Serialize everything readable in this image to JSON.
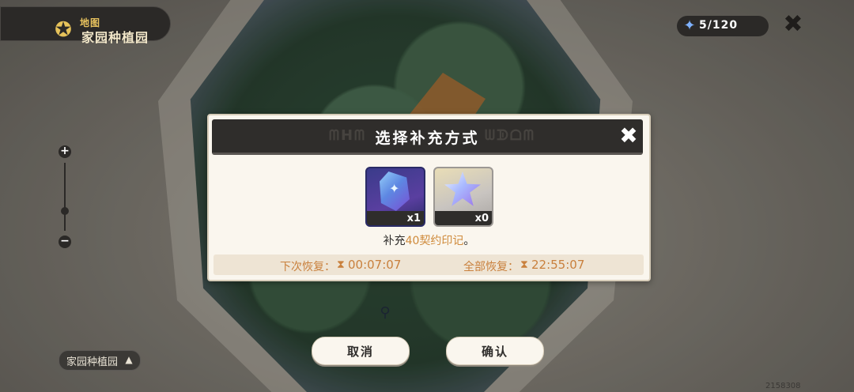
{
  "map": {
    "title_sub": "地图",
    "title_main": "家园种植园",
    "location_label": "家园种植园",
    "version_tag": "2158308"
  },
  "hud": {
    "stamina": "5/120",
    "icons": {
      "map": "map-icon",
      "stamina": "star-crystal-icon",
      "close": "close-icon",
      "zoom_in": "plus-icon",
      "zoom_out": "minus-icon",
      "location": "mountain-icon",
      "marker": "location-marker-icon"
    }
  },
  "dialog": {
    "title": "选择补充方式",
    "items": [
      {
        "name": "purple-crystal",
        "count": "x1"
      },
      {
        "name": "silver-star",
        "count": "x0"
      }
    ],
    "desc_prefix": "补充",
    "desc_highlight": "40契约印记",
    "desc_suffix": "。",
    "next_recover_label": "下次恢复：",
    "next_recover_time": "00:07:07",
    "full_recover_label": "全部恢复：",
    "full_recover_time": "22:55:07"
  },
  "buttons": {
    "cancel": "取消",
    "confirm": "确认"
  },
  "colors": {
    "accent": "#cf8a3b",
    "dark_panel": "#2f2d2b",
    "dialog_bg": "#faf6ee",
    "stamina_star": "#7fb2ff"
  }
}
